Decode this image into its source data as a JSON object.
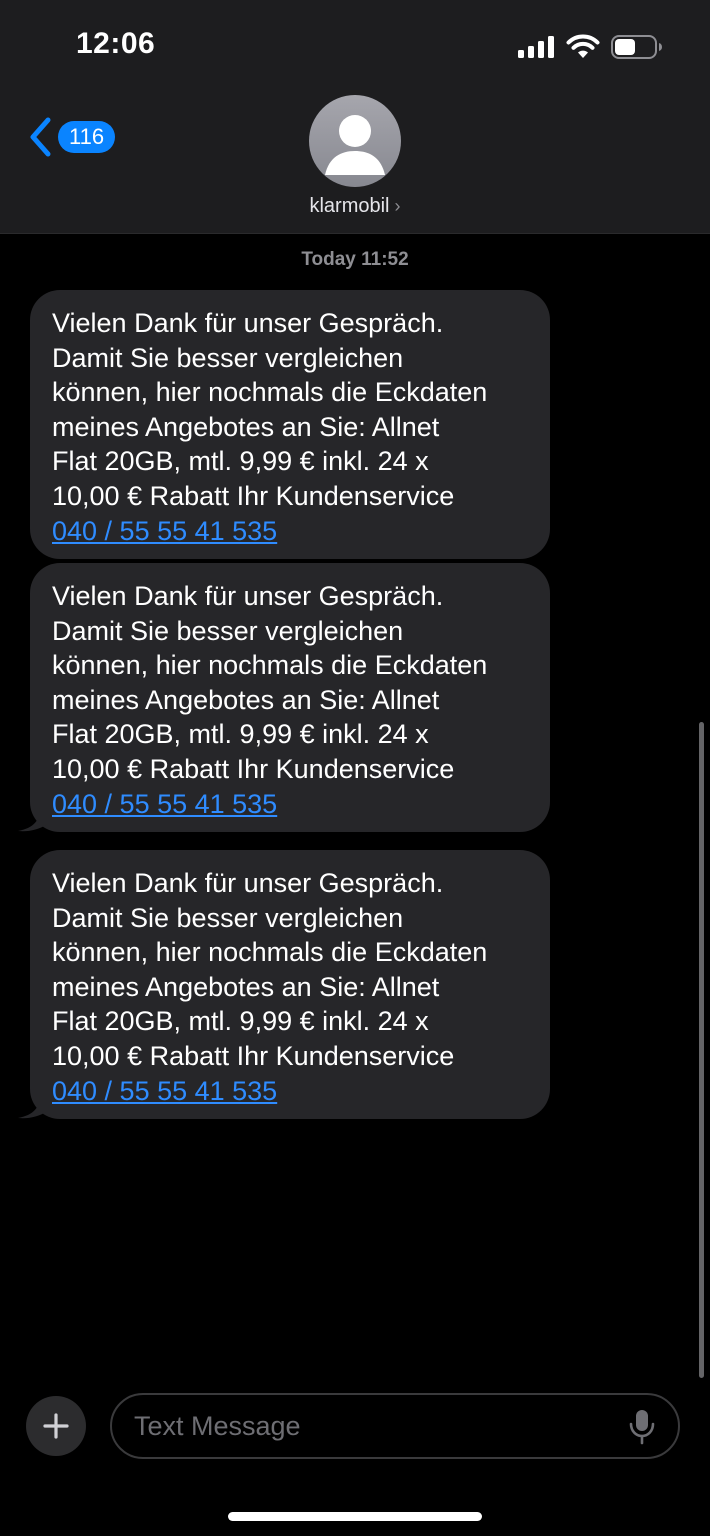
{
  "status_bar": {
    "time": "12:06",
    "icons": [
      "cellular-signal-icon",
      "wifi-icon",
      "battery-icon"
    ]
  },
  "nav": {
    "back_count": "116",
    "contact_name": "klarmobil",
    "contact_chevron": "›"
  },
  "conversation": {
    "timestamp_day": "Today",
    "timestamp_time": "11:52",
    "messages": [
      {
        "text": "Vielen Dank für unser Gespräch.\nDamit Sie besser vergleichen\nkönnen, hier nochmals die Eckdaten\nmeines Angebotes an Sie: Allnet\nFlat 20GB, mtl. 9,99 € inkl. 24 x\n10,00 € Rabatt Ihr Kundenservice",
        "link": "040 / 55 55 41 535"
      },
      {
        "text": "Vielen Dank für unser Gespräch.\nDamit Sie besser vergleichen\nkönnen, hier nochmals die Eckdaten\nmeines Angebotes an Sie: Allnet\nFlat 20GB, mtl. 9,99 € inkl. 24 x\n10,00 € Rabatt Ihr Kundenservice",
        "link": "040 / 55 55 41 535"
      },
      {
        "text": "Vielen Dank für unser Gespräch.\nDamit Sie besser vergleichen\nkönnen, hier nochmals die Eckdaten\nmeines Angebotes an Sie: Allnet\nFlat 20GB, mtl. 9,99 € inkl. 24 x\n10,00 € Rabatt Ihr Kundenservice",
        "link": "040 / 55 55 41 535"
      }
    ]
  },
  "composer": {
    "placeholder": "Text Message",
    "value": ""
  },
  "colors": {
    "accent": "#0a84ff",
    "link": "#2f8cff",
    "bubble": "#262629",
    "header": "#1d1d1f"
  }
}
